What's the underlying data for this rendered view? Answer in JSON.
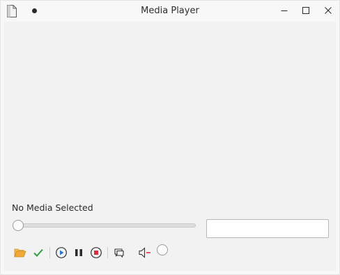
{
  "window": {
    "title": "Media Player"
  },
  "player": {
    "status": "No Media Selected",
    "seek_position": 0.0,
    "time_field_value": "",
    "volume_level": 0.0
  },
  "toolbar": {
    "icons": [
      "folder-open-icon",
      "checkmark-icon",
      "play-icon",
      "pause-icon",
      "stop-icon",
      "chat-icon",
      "volume-muted-icon"
    ]
  },
  "colors": {
    "folder": "#e8a431",
    "check": "#2ea043",
    "play": "#2a76c6",
    "stop": "#d8313d",
    "mute": "#e0303a"
  }
}
